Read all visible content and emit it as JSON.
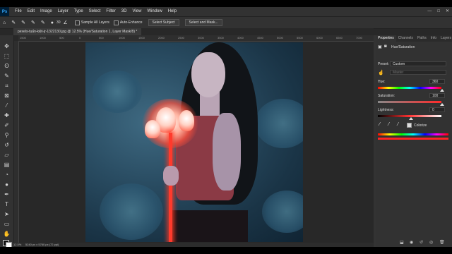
{
  "app": {
    "logo": "Ps"
  },
  "menubar": {
    "items": [
      "File",
      "Edit",
      "Image",
      "Layer",
      "Type",
      "Select",
      "Filter",
      "3D",
      "View",
      "Window",
      "Help"
    ],
    "controls": [
      "—",
      "□",
      "✕"
    ]
  },
  "options": {
    "sample_all_layers": "Sample All Layers",
    "auto_enhance": "Auto-Enhance",
    "select_subject": "Select Subject",
    "select_and_mask": "Select and Mask...",
    "size_value": "30"
  },
  "document": {
    "tab_title": "pexels-tuấn-kiệt-jr-1322130.jpg @ 12.5% (Hue/Saturation 1, Layer Mask/8) *"
  },
  "ruler": {
    "marks": [
      "1500",
      "1000",
      "500",
      "0",
      "500",
      "1000",
      "1500",
      "2000",
      "2500",
      "3000",
      "3500",
      "4000",
      "4500",
      "5000",
      "5500",
      "6000",
      "6500",
      "7000"
    ]
  },
  "status": {
    "zoom": "12.5%",
    "size": "5240 px x 5760 px (72 ppi)"
  },
  "properties": {
    "tabs": [
      "Properties",
      "Channels",
      "Paths",
      "Info",
      "Layers"
    ],
    "adjustment_title": "Hue/Saturation",
    "preset_label": "Preset:",
    "preset_value": "Custom",
    "channel_value": "Master",
    "hue_label": "Hue:",
    "hue_value": "360",
    "saturation_label": "Saturation:",
    "saturation_value": "100",
    "lightness_label": "Lightness:",
    "lightness_value": "0",
    "colorize_label": "Colorize"
  },
  "colors": {
    "accent": "#31a8ff",
    "glow": "#ff3a2c"
  }
}
